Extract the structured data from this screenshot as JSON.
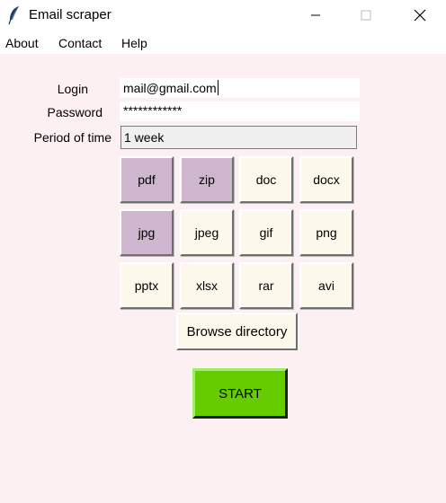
{
  "window": {
    "title": "Email scraper",
    "icon": "feather-icon",
    "controls": [
      "minimize-icon",
      "maximize-icon",
      "close-icon"
    ]
  },
  "menu": [
    "About",
    "Contact",
    "Help"
  ],
  "form": {
    "login_label": "Login",
    "login_value": "mail@gmail.com",
    "password_label": "Password",
    "password_value": "************",
    "period_label": "Period of time",
    "period_value": "1 week"
  },
  "file_types": [
    {
      "label": "pdf",
      "selected": true
    },
    {
      "label": "zip",
      "selected": true
    },
    {
      "label": "doc",
      "selected": false
    },
    {
      "label": "docx",
      "selected": false
    },
    {
      "label": "jpg",
      "selected": true
    },
    {
      "label": "jpeg",
      "selected": false
    },
    {
      "label": "gif",
      "selected": false
    },
    {
      "label": "png",
      "selected": false
    },
    {
      "label": "pptx",
      "selected": false
    },
    {
      "label": "xlsx",
      "selected": false
    },
    {
      "label": "rar",
      "selected": false
    },
    {
      "label": "avi",
      "selected": false
    }
  ],
  "browse_label": "Browse directory",
  "start_label": "START",
  "colors": {
    "background": "#fdf0f3",
    "button": "#fdf8ec",
    "selected": "#cdb6ce",
    "start": "#66cc00"
  }
}
